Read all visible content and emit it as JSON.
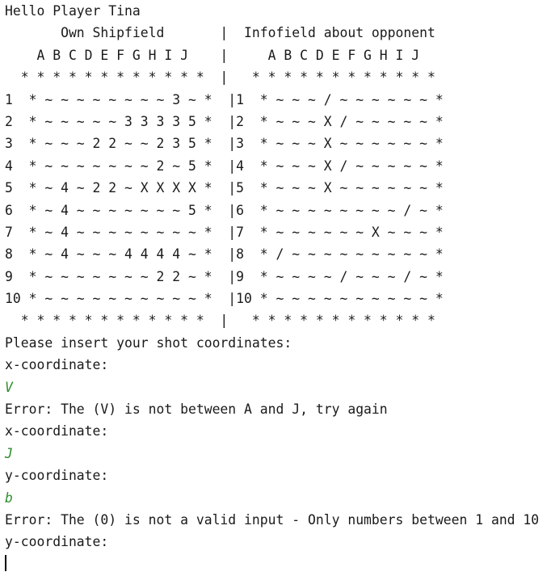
{
  "console": {
    "lines": [
      {
        "text": "Hello Player Tina",
        "kind": "output"
      },
      {
        "text": "       Own Shipfield       |  Infofield about opponent",
        "kind": "output"
      },
      {
        "text": "    A B C D E F G H I J    |     A B C D E F G H I J",
        "kind": "output"
      },
      {
        "text": "  * * * * * * * * * * * *  |   * * * * * * * * * * * *",
        "kind": "output"
      },
      {
        "text": "1  * ~ ~ ~ ~ ~ ~ ~ ~ 3 ~ *  |1  * ~ ~ ~ / ~ ~ ~ ~ ~ ~ *",
        "kind": "output"
      },
      {
        "text": "2  * ~ ~ ~ ~ ~ 3 3 3 3 5 *  |2  * ~ ~ ~ X / ~ ~ ~ ~ ~ *",
        "kind": "output"
      },
      {
        "text": "3  * ~ ~ ~ 2 2 ~ ~ 2 3 5 *  |3  * ~ ~ ~ X ~ ~ ~ ~ ~ ~ *",
        "kind": "output"
      },
      {
        "text": "4  * ~ ~ ~ ~ ~ ~ ~ 2 ~ 5 *  |4  * ~ ~ ~ X / ~ ~ ~ ~ ~ *",
        "kind": "output"
      },
      {
        "text": "5  * ~ 4 ~ 2 2 ~ X X X X *  |5  * ~ ~ ~ X ~ ~ ~ ~ ~ ~ *",
        "kind": "output"
      },
      {
        "text": "6  * ~ 4 ~ ~ ~ ~ ~ ~ ~ 5 *  |6  * ~ ~ ~ ~ ~ ~ ~ ~ / ~ *",
        "kind": "output"
      },
      {
        "text": "7  * ~ 4 ~ ~ ~ ~ ~ ~ ~ ~ *  |7  * ~ ~ ~ ~ ~ ~ X ~ ~ ~ *",
        "kind": "output"
      },
      {
        "text": "8  * ~ 4 ~ ~ ~ 4 4 4 4 ~ *  |8  * / ~ ~ ~ ~ ~ ~ ~ ~ ~ *",
        "kind": "output"
      },
      {
        "text": "9  * ~ ~ ~ ~ ~ ~ ~ 2 2 ~ *  |9  * ~ ~ ~ ~ / ~ ~ ~ / ~ *",
        "kind": "output"
      },
      {
        "text": "10 * ~ ~ ~ ~ ~ ~ ~ ~ ~ ~ *  |10 * ~ ~ ~ ~ ~ ~ ~ ~ ~ ~ *",
        "kind": "output"
      },
      {
        "text": "  * * * * * * * * * * * *  |   * * * * * * * * * * * *",
        "kind": "output"
      },
      {
        "text": "Please insert your shot coordinates:",
        "kind": "output"
      },
      {
        "text": "x-coordinate:",
        "kind": "output"
      },
      {
        "text": "V",
        "kind": "input"
      },
      {
        "text": "Error: The (V) is not between A and J, try again",
        "kind": "output"
      },
      {
        "text": "x-coordinate:",
        "kind": "output"
      },
      {
        "text": "J",
        "kind": "input"
      },
      {
        "text": "y-coordinate:",
        "kind": "output"
      },
      {
        "text": "b",
        "kind": "input"
      },
      {
        "text": "Error: The (0) is not a valid input - Only numbers between 1 and 10",
        "kind": "output"
      },
      {
        "text": "y-coordinate:",
        "kind": "output"
      }
    ]
  }
}
